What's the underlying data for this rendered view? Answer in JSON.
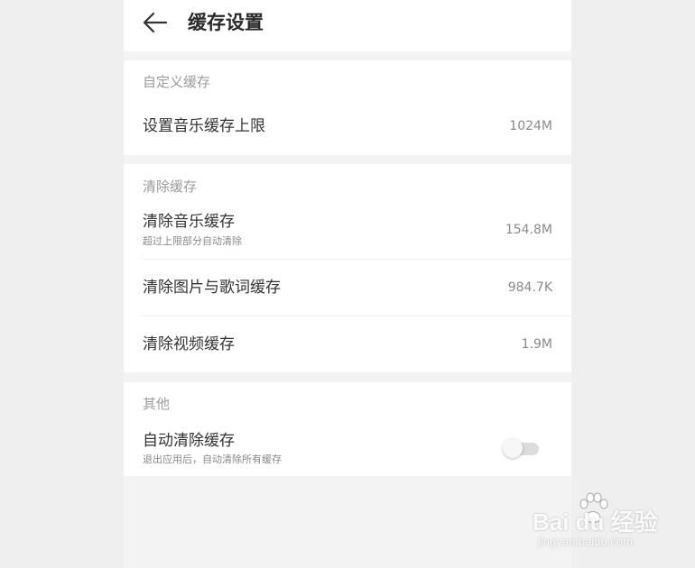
{
  "header": {
    "title": "缓存设置"
  },
  "sections": {
    "custom": {
      "title": "自定义缓存",
      "items": [
        {
          "label": "设置音乐缓存上限",
          "value": "1024M"
        }
      ]
    },
    "clear": {
      "title": "清除缓存",
      "items": [
        {
          "label": "清除音乐缓存",
          "sublabel": "超过上限部分自动清除",
          "value": "154.8M"
        },
        {
          "label": "清除图片与歌词缓存",
          "value": "984.7K"
        },
        {
          "label": "清除视频缓存",
          "value": "1.9M"
        }
      ]
    },
    "other": {
      "title": "其他",
      "items": [
        {
          "label": "自动清除缓存",
          "sublabel": "退出应用后，自动清除所有缓存",
          "toggle_on": false
        }
      ]
    }
  },
  "watermark": {
    "brand": "Bai du 经验",
    "url": "jingyan.baidu.com"
  }
}
